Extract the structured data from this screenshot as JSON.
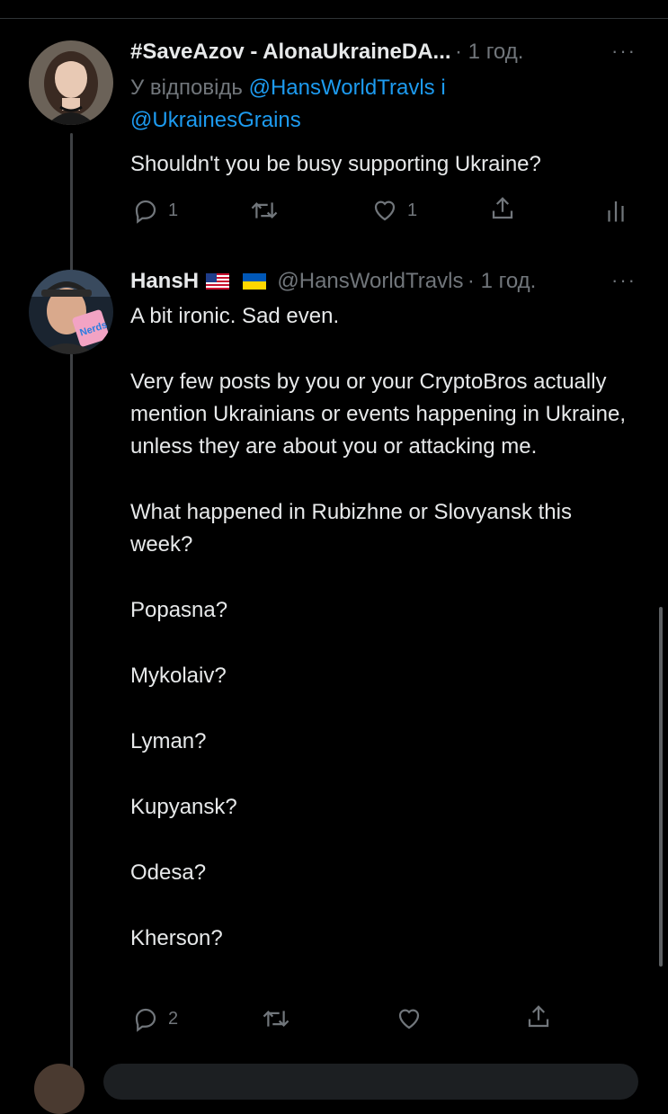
{
  "tweet1": {
    "display_name": "#SaveAzov - AlonaUkraineDA...",
    "time": "· 1 год.",
    "more_label": "···",
    "reply_prefix": "У відповідь",
    "reply_mention_1": "@HansWorldTravls",
    "reply_conjunction": "і",
    "reply_mention_2": "@UkrainesGrains",
    "text": "Shouldn't you be busy supporting Ukraine?",
    "reply_count": "1",
    "like_count": "1"
  },
  "tweet2": {
    "display_name": "HansH",
    "handle": "@HansWorldTravls",
    "time": "· 1 год.",
    "more_label": "···",
    "avatar_text": "Nerds",
    "paragraphs": [
      "A bit ironic. Sad even.",
      "Very few posts by you or your CryptoBros actually mention Ukrainians or events happening in Ukraine, unless they are about you or attacking me.",
      "What happened in Rubizhne or Slovyansk this week?",
      "Popasna?",
      "Mykolaiv?",
      "Lyman?",
      "Kupyansk?",
      "Odesa?",
      "Kherson?"
    ],
    "reply_count": "2"
  },
  "colors": {
    "background": "#000000",
    "text": "#e7e9ea",
    "muted": "#71767b",
    "link": "#1d9bf0"
  },
  "icons": [
    "reply-icon",
    "retweet-icon",
    "like-icon",
    "share-icon",
    "analytics-icon",
    "more-icon"
  ]
}
